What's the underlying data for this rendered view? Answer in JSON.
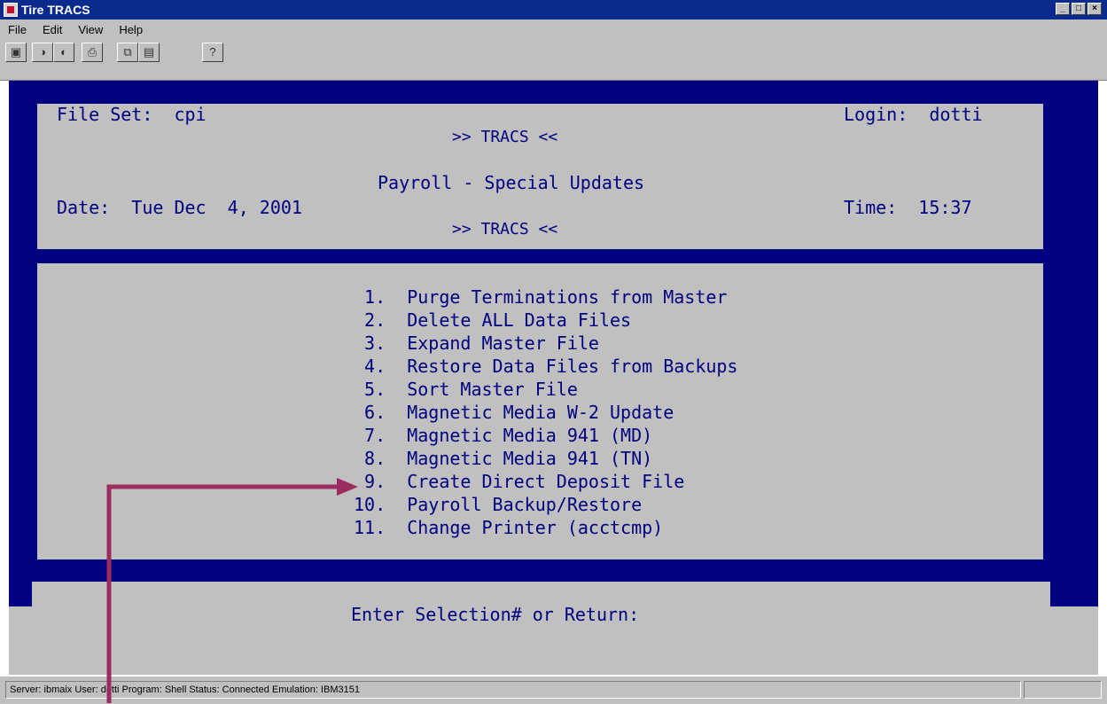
{
  "window": {
    "title": "Tire TRACS",
    "controls": [
      "minimize",
      "maximize",
      "close"
    ]
  },
  "menu": [
    "File",
    "Edit",
    "View",
    "Help"
  ],
  "toolbar": {
    "icons": [
      "properties-icon",
      "connect-icon",
      "print-icon",
      "copy-icon",
      "paste-icon",
      "help-icon"
    ]
  },
  "terminal": {
    "fileset_label": "File Set:  cpi",
    "login_label": "Login:  dotti",
    "banner_top": ">> TRACS <<",
    "screen_title": "Payroll - Special Updates",
    "date_label": "Date:  Tue Dec  4, 2001",
    "time_label": "Time:  15:37",
    "banner_bottom": ">> TRACS <<",
    "menu_items": [
      " 1.  Purge Terminations from Master",
      " 2.  Delete ALL Data Files",
      " 3.  Expand Master File",
      " 4.  Restore Data Files from Backups",
      " 5.  Sort Master File",
      " 6.  Magnetic Media W-2 Update",
      " 7.  Magnetic Media 941 (MD)",
      " 8.  Magnetic Media 941 (TN)",
      " 9.  Create Direct Deposit File",
      "10.  Payroll Backup/Restore",
      "11.  Change Printer (acctcmp)"
    ],
    "prompt": "Enter Selection# or Return:"
  },
  "status": "Server: ibmaix   User: dotti   Program: Shell   Status: Connected   Emulation: IBM3151",
  "colors": {
    "terminal_bg": "#c0c0c0",
    "terminal_fg": "#000080",
    "annotation_arrow": "#9b2d5e"
  }
}
